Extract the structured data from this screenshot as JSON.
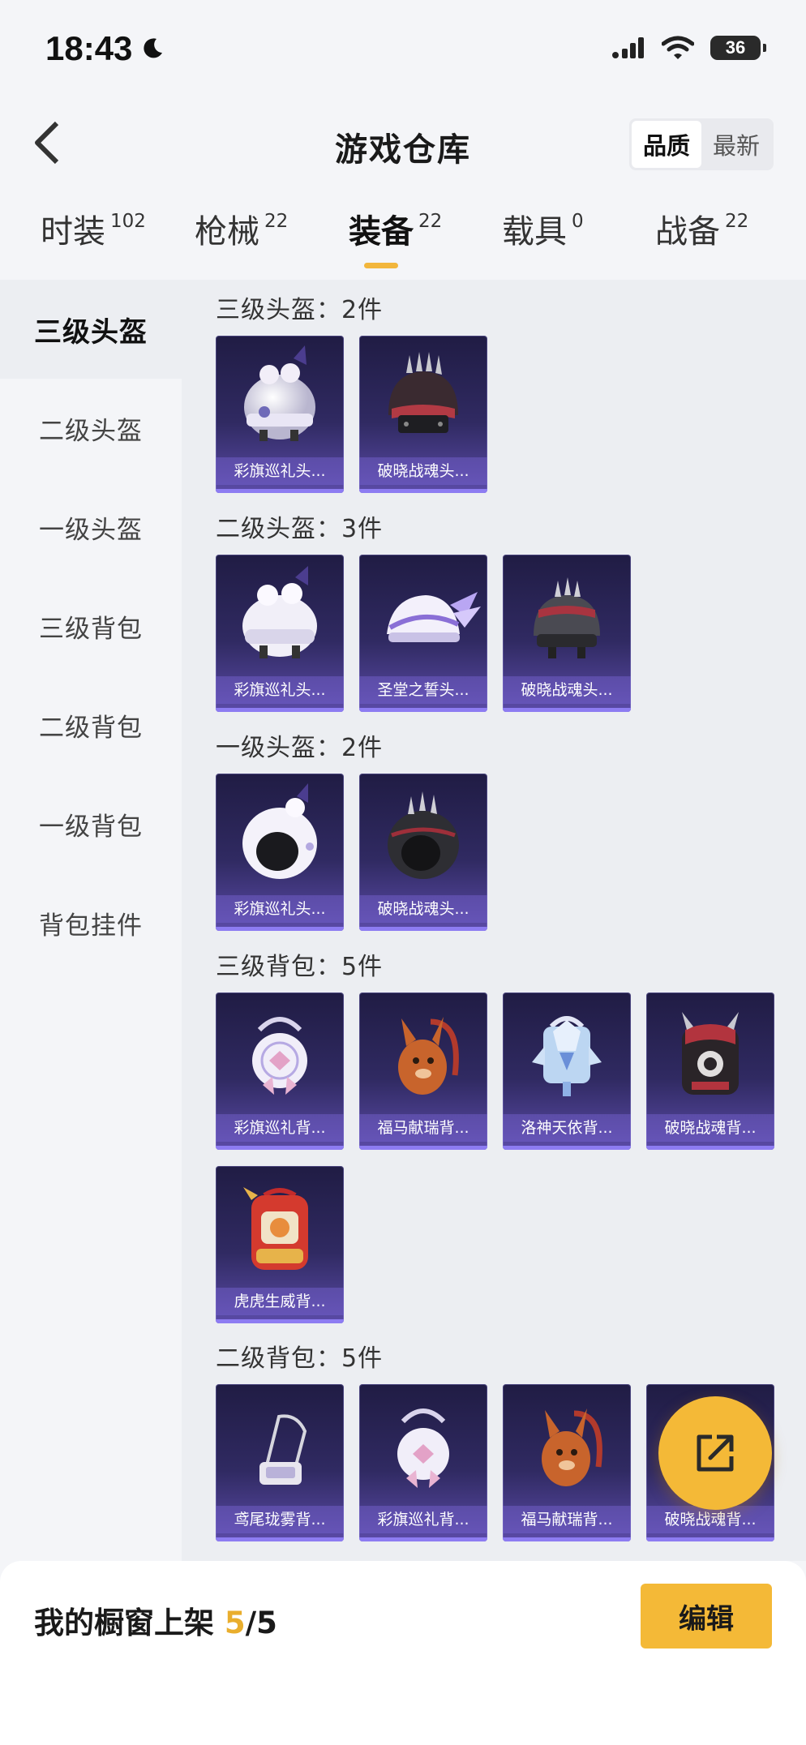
{
  "status_bar": {
    "time": "18:43",
    "battery": "36"
  },
  "header": {
    "title": "游戏仓库",
    "sort_options": [
      "品质",
      "最新"
    ],
    "active_sort": 0
  },
  "tabs": [
    {
      "label": "时装",
      "count": "102"
    },
    {
      "label": "枪械",
      "count": "22"
    },
    {
      "label": "装备",
      "count": "22",
      "active": true
    },
    {
      "label": "载具",
      "count": "0"
    },
    {
      "label": "战备",
      "count": "22"
    }
  ],
  "sidebar": {
    "items": [
      "三级头盔",
      "二级头盔",
      "一级头盔",
      "三级背包",
      "二级背包",
      "一级背包",
      "背包挂件"
    ],
    "active_index": 0
  },
  "sections": [
    {
      "title": "三级头盔：2件",
      "items": [
        {
          "label": "彩旗巡礼头...",
          "icon": "helmet-icon"
        },
        {
          "label": "破晓战魂头...",
          "icon": "helmet-icon"
        }
      ]
    },
    {
      "title": "二级头盔：3件",
      "items": [
        {
          "label": "彩旗巡礼头...",
          "icon": "helmet-icon"
        },
        {
          "label": "圣堂之誓头...",
          "icon": "helmet-icon"
        },
        {
          "label": "破晓战魂头...",
          "icon": "helmet-icon"
        }
      ]
    },
    {
      "title": "一级头盔：2件",
      "items": [
        {
          "label": "彩旗巡礼头...",
          "icon": "helmet-icon"
        },
        {
          "label": "破晓战魂头...",
          "icon": "helmet-icon"
        }
      ]
    },
    {
      "title": "三级背包：5件",
      "items": [
        {
          "label": "彩旗巡礼背...",
          "icon": "backpack-icon"
        },
        {
          "label": "福马献瑞背...",
          "icon": "backpack-icon"
        },
        {
          "label": "洛神天依背...",
          "icon": "backpack-icon"
        },
        {
          "label": "破晓战魂背...",
          "icon": "backpack-icon"
        },
        {
          "label": "虎虎生威背...",
          "icon": "backpack-icon"
        }
      ]
    },
    {
      "title": "二级背包：5件",
      "items": [
        {
          "label": "鸢尾珑雾背...",
          "icon": "backpack-icon"
        },
        {
          "label": "彩旗巡礼背...",
          "icon": "backpack-icon"
        },
        {
          "label": "福马献瑞背...",
          "icon": "backpack-icon"
        },
        {
          "label": "破晓战魂背...",
          "icon": "backpack-icon"
        }
      ]
    }
  ],
  "bottom_bar": {
    "showcase_label": "我的橱窗上架",
    "showcase_count": "5",
    "showcase_total": "/5",
    "edit_label": "编辑"
  },
  "colors": {
    "accent": "#f4b937",
    "card_bg_top": "#201c44",
    "card_bg_bottom": "#5b4ba8"
  }
}
